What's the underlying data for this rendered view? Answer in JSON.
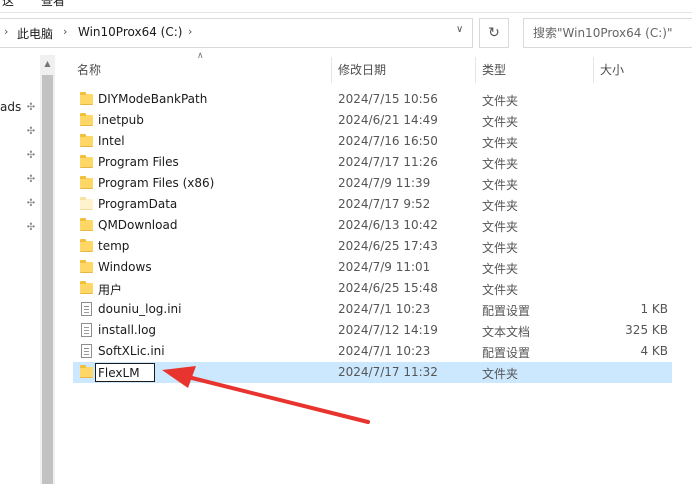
{
  "ribbon": {
    "left_fragment": "这",
    "right_fragment": "查看"
  },
  "address_bar": {
    "segments": [
      "此电脑",
      "Win10Prox64 (C:)"
    ],
    "dropdown_icon": "chevron-down-icon"
  },
  "refresh_icon": "refresh-icon",
  "search": {
    "placeholder": "搜索\"Win10Prox64 (C:)\""
  },
  "nav": {
    "partial_label": "ads"
  },
  "columns": {
    "name": "名称",
    "date": "修改日期",
    "type": "类型",
    "size": "大小"
  },
  "files": [
    {
      "name": "DIYModeBankPath",
      "date": "2024/7/15 10:56",
      "type": "文件夹",
      "size": "",
      "icon": "folder-icon"
    },
    {
      "name": "inetpub",
      "date": "2024/6/21 14:49",
      "type": "文件夹",
      "size": "",
      "icon": "folder-icon"
    },
    {
      "name": "Intel",
      "date": "2024/7/16 16:50",
      "type": "文件夹",
      "size": "",
      "icon": "folder-icon"
    },
    {
      "name": "Program Files",
      "date": "2024/7/17 11:26",
      "type": "文件夹",
      "size": "",
      "icon": "folder-icon"
    },
    {
      "name": "Program Files (x86)",
      "date": "2024/7/9 11:39",
      "type": "文件夹",
      "size": "",
      "icon": "folder-icon"
    },
    {
      "name": "ProgramData",
      "date": "2024/7/17 9:52",
      "type": "文件夹",
      "size": "",
      "icon": "hidden-folder-icon"
    },
    {
      "name": "QMDownload",
      "date": "2024/6/13 10:42",
      "type": "文件夹",
      "size": "",
      "icon": "folder-icon"
    },
    {
      "name": "temp",
      "date": "2024/6/25 17:43",
      "type": "文件夹",
      "size": "",
      "icon": "folder-icon"
    },
    {
      "name": "Windows",
      "date": "2024/7/9 11:01",
      "type": "文件夹",
      "size": "",
      "icon": "folder-icon"
    },
    {
      "name": "用户",
      "date": "2024/6/25 15:48",
      "type": "文件夹",
      "size": "",
      "icon": "folder-icon"
    },
    {
      "name": "douniu_log.ini",
      "date": "2024/7/1 10:23",
      "type": "配置设置",
      "size": "1 KB",
      "icon": "settings-file-icon"
    },
    {
      "name": "install.log",
      "date": "2024/7/12 14:19",
      "type": "文本文档",
      "size": "325 KB",
      "icon": "text-file-icon"
    },
    {
      "name": "SoftXLic.ini",
      "date": "2024/7/1 10:23",
      "type": "配置设置",
      "size": "4 KB",
      "icon": "settings-file-icon"
    }
  ],
  "new_folder": {
    "name": "FlexLM",
    "date": "2024/7/17 11:32",
    "type": "文件夹",
    "icon": "folder-icon"
  },
  "colors": {
    "selection": "#cce8ff",
    "annotation_arrow": "#e8332f",
    "folder": "#ffd766"
  }
}
